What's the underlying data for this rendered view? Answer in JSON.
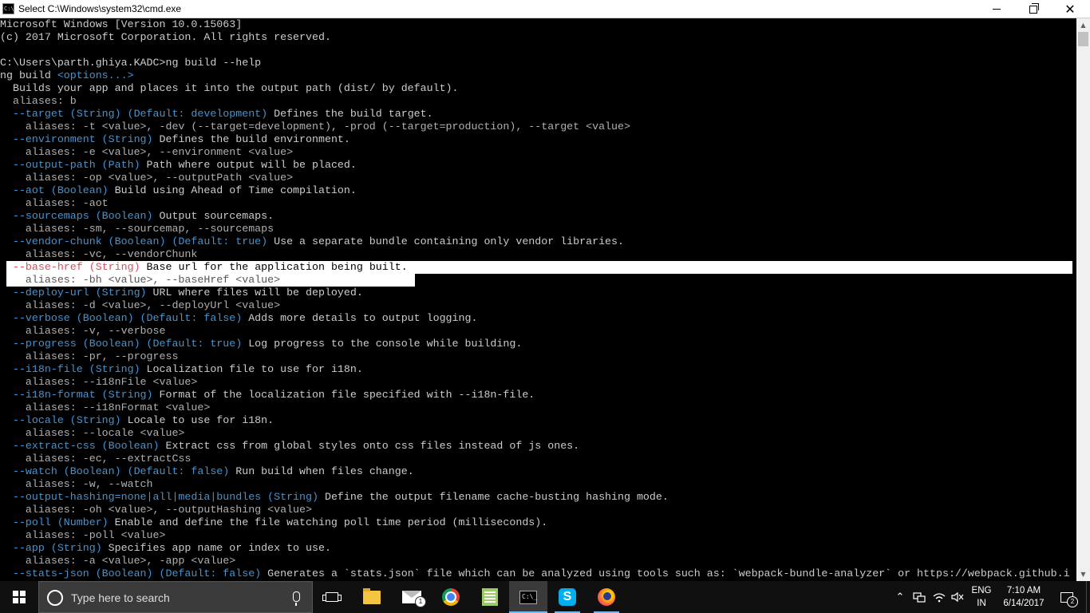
{
  "window": {
    "title": "Select C:\\Windows\\system32\\cmd.exe",
    "app_icon_text": "C:\\",
    "minimize_icon": "minimize-icon",
    "maximize_icon": "restore-icon",
    "close_label": "✕"
  },
  "console": {
    "lines": [
      [
        {
          "t": "Microsoft Windows [Version 10.0.15063]"
        }
      ],
      [
        {
          "t": "(c) 2017 Microsoft Corporation. All rights reserved."
        }
      ],
      [
        {
          "t": ""
        }
      ],
      [
        {
          "t": "C:\\Users\\parth.ghiya.KADC>ng build --help"
        }
      ],
      [
        {
          "t": "ng build "
        },
        {
          "t": "<options...>",
          "c": "teal"
        }
      ],
      [
        {
          "t": "  Builds your app and places it into the output path (dist/ by default)."
        }
      ],
      [
        {
          "t": "  aliases: b",
          "c": "gray"
        }
      ],
      [
        {
          "t": "  --target (String) (Default: development)",
          "c": "teal"
        },
        {
          "t": " Defines the build target."
        }
      ],
      [
        {
          "t": "    aliases: -t <value>, -dev (--target=development), -prod (--target=production), --target <value>",
          "c": "gray"
        }
      ],
      [
        {
          "t": "  --environment (String)",
          "c": "teal"
        },
        {
          "t": " Defines the build environment."
        }
      ],
      [
        {
          "t": "    aliases: -e <value>, --environment <value>",
          "c": "gray"
        }
      ],
      [
        {
          "t": "  --output-path (Path)",
          "c": "teal"
        },
        {
          "t": " Path where output will be placed."
        }
      ],
      [
        {
          "t": "    aliases: -op <value>, --outputPath <value>",
          "c": "gray"
        }
      ],
      [
        {
          "t": "  --aot (Boolean)",
          "c": "teal"
        },
        {
          "t": " Build using Ahead of Time compilation."
        }
      ],
      [
        {
          "t": "    aliases: -aot",
          "c": "gray"
        }
      ],
      [
        {
          "t": "  --sourcemaps (Boolean)",
          "c": "teal"
        },
        {
          "t": " Output sourcemaps."
        }
      ],
      [
        {
          "t": "    aliases: -sm, --sourcemap, --sourcemaps",
          "c": "gray"
        }
      ],
      [
        {
          "t": "  --vendor-chunk (Boolean) (Default: true)",
          "c": "teal"
        },
        {
          "t": " Use a separate bundle containing only vendor libraries."
        }
      ],
      [
        {
          "t": "    aliases: -vc, --vendorChunk",
          "c": "gray"
        }
      ],
      [
        {
          "t": "  --base-href (String)",
          "c": "red"
        },
        {
          "t": " Base url for the application being built."
        }
      ],
      [
        {
          "t": "    aliases: -bh <value>, --baseHref <value>",
          "c": "gray"
        }
      ],
      [
        {
          "t": "  --deploy-url (String)",
          "c": "teal"
        },
        {
          "t": " URL where files will be deployed."
        }
      ],
      [
        {
          "t": "    aliases: -d <value>, --deployUrl <value>",
          "c": "gray"
        }
      ],
      [
        {
          "t": "  --verbose (Boolean) (Default: false)",
          "c": "teal"
        },
        {
          "t": " Adds more details to output logging."
        }
      ],
      [
        {
          "t": "    aliases: -v, --verbose",
          "c": "gray"
        }
      ],
      [
        {
          "t": "  --progress (Boolean) (Default: true)",
          "c": "teal"
        },
        {
          "t": " Log progress to the console while building."
        }
      ],
      [
        {
          "t": "    aliases: -pr, --progress",
          "c": "gray"
        }
      ],
      [
        {
          "t": "  --i18n-file (String)",
          "c": "teal"
        },
        {
          "t": " Localization file to use for i18n."
        }
      ],
      [
        {
          "t": "    aliases: --i18nFile <value>",
          "c": "gray"
        }
      ],
      [
        {
          "t": "  --i18n-format (String)",
          "c": "teal"
        },
        {
          "t": " Format of the localization file specified with --i18n-file."
        }
      ],
      [
        {
          "t": "    aliases: --i18nFormat <value>",
          "c": "gray"
        }
      ],
      [
        {
          "t": "  --locale (String)",
          "c": "teal"
        },
        {
          "t": " Locale to use for i18n."
        }
      ],
      [
        {
          "t": "    aliases: --locale <value>",
          "c": "gray"
        }
      ],
      [
        {
          "t": "  --extract-css (Boolean)",
          "c": "teal"
        },
        {
          "t": " Extract css from global styles onto css files instead of js ones."
        }
      ],
      [
        {
          "t": "    aliases: -ec, --extractCss",
          "c": "gray"
        }
      ],
      [
        {
          "t": "  --watch (Boolean) (Default: false)",
          "c": "teal"
        },
        {
          "t": " Run build when files change."
        }
      ],
      [
        {
          "t": "    aliases: -w, --watch",
          "c": "gray"
        }
      ],
      [
        {
          "t": "  --output-hashing=none|all|media|bundles (String)",
          "c": "teal"
        },
        {
          "t": " Define the output filename cache-busting hashing mode."
        }
      ],
      [
        {
          "t": "    aliases: -oh <value>, --outputHashing <value>",
          "c": "gray"
        }
      ],
      [
        {
          "t": "  --poll (Number)",
          "c": "teal"
        },
        {
          "t": " Enable and define the file watching poll time period (milliseconds)."
        }
      ],
      [
        {
          "t": "    aliases: -poll <value>",
          "c": "gray"
        }
      ],
      [
        {
          "t": "  --app (String)",
          "c": "teal"
        },
        {
          "t": " Specifies app name or index to use."
        }
      ],
      [
        {
          "t": "    aliases: -a <value>, -app <value>",
          "c": "gray"
        }
      ],
      [
        {
          "t": "  --stats-json (Boolean) (Default: false)",
          "c": "teal"
        },
        {
          "t": " Generates a `stats.json` file which can be analyzed using tools such as: `webpack-bundle-analyzer` or https://webpack.github.i"
        }
      ]
    ],
    "selected_lines": [
      19,
      20
    ]
  },
  "scrollbar": {
    "up_icon": "▲",
    "down_icon": "▼"
  },
  "taskbar": {
    "search_placeholder": "Type here to search",
    "mail_badge": "1",
    "cmd_icon_text": "C:\\_",
    "skype_letter": "S",
    "tray_chevron": "⌃",
    "lang_line1": "ENG",
    "lang_line2": "IN",
    "time": "7:10 AM",
    "date": "6/14/2017",
    "notification_count": "2"
  },
  "colors": {
    "console_bg": "#000000",
    "console_text": "#cccccc",
    "option_text": "#3a96dd",
    "selection_bg": "#ffffff",
    "highlight_option": "#e74856",
    "taskbar_bg": "#101010"
  }
}
